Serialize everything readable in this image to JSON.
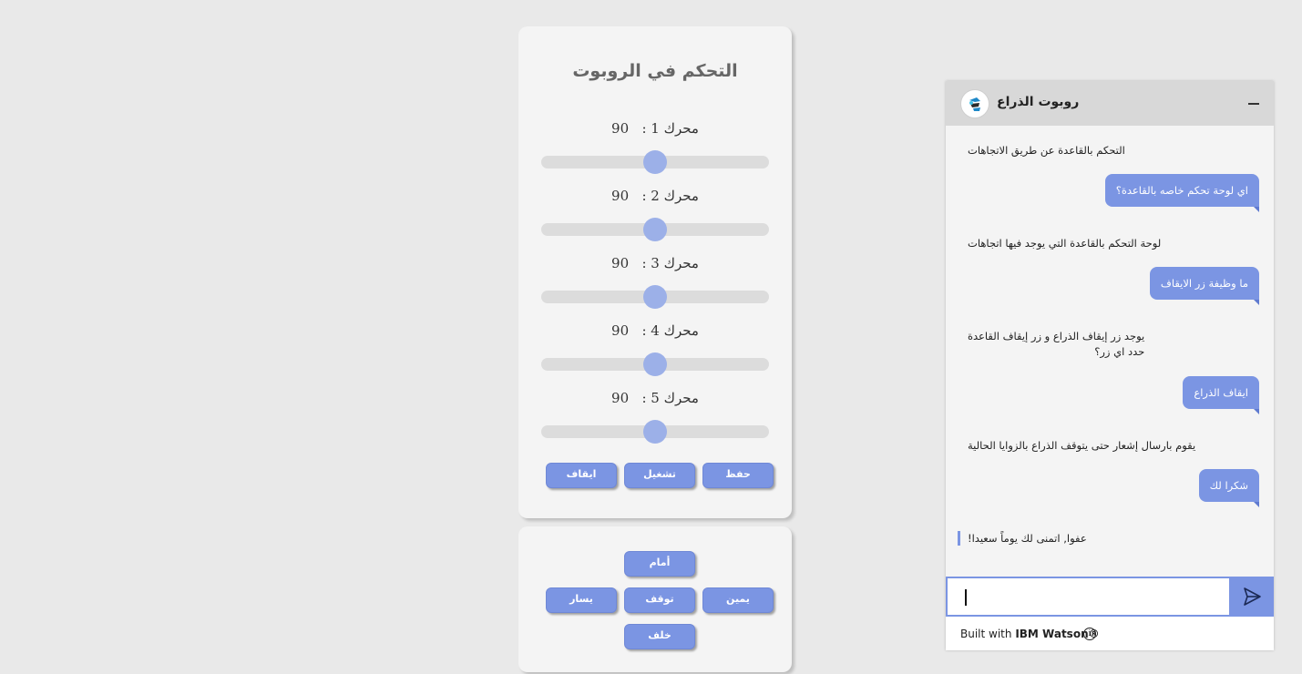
{
  "control_panel": {
    "title": "التحكم في الروبوت",
    "motors": [
      {
        "label": "محرك 1 :",
        "value": "90",
        "level_percent": 50
      },
      {
        "label": "محرك 2 :",
        "value": "90",
        "level_percent": 50
      },
      {
        "label": "محرك 3 :",
        "value": "90",
        "level_percent": 50
      },
      {
        "label": "محرك 4 :",
        "value": "90",
        "level_percent": 50
      },
      {
        "label": "محرك 5 :",
        "value": "90",
        "level_percent": 50
      }
    ],
    "buttons": {
      "save": "حفظ",
      "run": "تشغيل",
      "stop": "ايقاف"
    }
  },
  "direction_panel": {
    "forward": "أمام",
    "right": "يمين",
    "stop": "توقف",
    "left": "يسار",
    "back": "خلف"
  },
  "chat": {
    "bot_name": "روبوت الذراع",
    "messages": [
      {
        "from": "bot",
        "text": "التحكم بالقاعدة عن طريق الاتجاهات"
      },
      {
        "from": "user",
        "text": "اي لوحة تحكم خاصه بالقاعدة؟"
      },
      {
        "from": "bot",
        "text": "لوحة التحكم بالقاعدة التي يوجد فيها اتجاهات"
      },
      {
        "from": "user",
        "text": "ما وظيفة زر الايقاف"
      },
      {
        "from": "bot",
        "text": "يوجد زر إيقاف الذراع و زر إيقاف القاعدة",
        "text2": "حدد اي زر؟"
      },
      {
        "from": "user",
        "text": "ايقاف الذراع"
      },
      {
        "from": "bot",
        "text": "يقوم بارسال إشعار حتى يتوقف الذراع بالزوايا الحالية"
      },
      {
        "from": "user",
        "text": "شكرا لك"
      },
      {
        "from": "bot",
        "text": "عفوا, اتمنى لك يوماً سعيدا!"
      }
    ],
    "input_value": "",
    "footer_prefix": "Built with",
    "footer_brand": "IBM Watson®",
    "accent_color": "#7b95e3"
  }
}
